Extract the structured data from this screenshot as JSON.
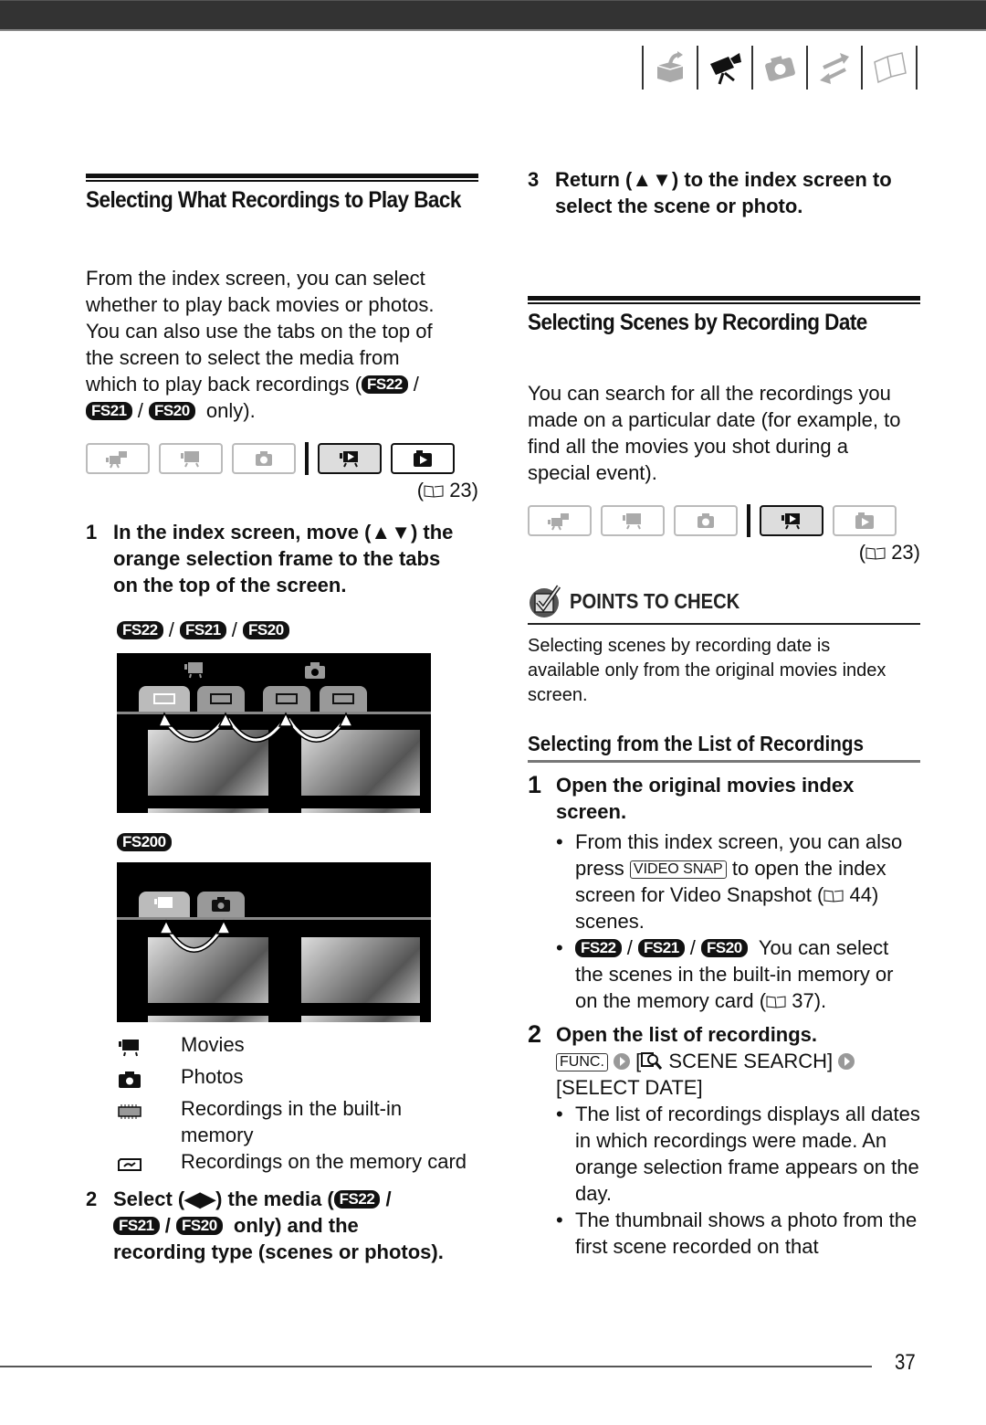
{
  "header": {
    "chapter_icons": [
      "intro-box-icon",
      "movie-camera-icon",
      "photo-camera-icon",
      "transfer-arrows-icon",
      "book-icon"
    ],
    "active_chapter": "movie-camera-icon"
  },
  "left": {
    "section_title": "Selecting What Recordings to Play Back",
    "intro_lines": [
      "From the index screen, you can select",
      "whether to play back movies or photos.",
      "You can also use the tabs on the top of",
      "the screen to select the media from",
      "which to play back recordings ("
    ],
    "intro_tail": "only).",
    "models": {
      "fs22": "FS22",
      "fs21": "FS21",
      "fs20": "FS20",
      "fs200": "FS200"
    },
    "sep": "/",
    "tab_ref": "23",
    "step1": {
      "num": "1",
      "lines": [
        "In the index screen, move (▲▼) the",
        "orange selection frame to the tabs",
        "on the top of the screen."
      ]
    },
    "legend": [
      {
        "icon": "movie-icon",
        "label": "Movies"
      },
      {
        "icon": "photo-icon",
        "label": "Photos"
      },
      {
        "icon": "built-in-memory-icon",
        "label": "Recordings in the built-in memory"
      },
      {
        "icon": "memory-card-icon",
        "label": "Recordings on the memory card"
      }
    ],
    "step2": {
      "num": "2",
      "pre": "Select (◀▶) the media (",
      "mid": "only) and the",
      "last": "recording type (scenes or photos)."
    }
  },
  "right": {
    "step3": {
      "num": "3",
      "lines": [
        "Return (▲▼) to the index screen to",
        "select the scene or photo."
      ]
    },
    "section_title": "Selecting Scenes by Recording Date",
    "intro": "You can search for all the recordings you made on a particular date (for example, to find all the movies you shot during a special event).",
    "tab_ref": "23",
    "points_title": "POINTS TO CHECK",
    "points_text": "Selecting scenes by recording date is available only from the original movies index screen.",
    "subsection_title": "Selecting from the List of Recordings",
    "step1": {
      "num": "1",
      "title_lines": [
        "Open the original movies index",
        "screen."
      ],
      "bullet1_pre": "From this index screen, you can also press",
      "bullet1_key": "VIDEO SNAP",
      "bullet1_post": "to open the index screen for Video Snapshot",
      "bullet1_ref": "44",
      "bullet1_end": "scenes.",
      "bullet2_post": "You can select the scenes in the built-in memory or on the memory card",
      "bullet2_ref": "37"
    },
    "step2": {
      "num": "2",
      "title": "Open the list of recordings.",
      "func_key": "FUNC.",
      "menu_item": "SCENE SEARCH]",
      "menu_open": "[",
      "menu_item2": "[SELECT DATE]",
      "bullets": [
        "The list of recordings displays all dates in which recordings were made. An orange selection frame appears on the day.",
        "The thumbnail shows a photo from the first scene recorded on that"
      ]
    }
  },
  "footer": {
    "page_number": "37"
  }
}
